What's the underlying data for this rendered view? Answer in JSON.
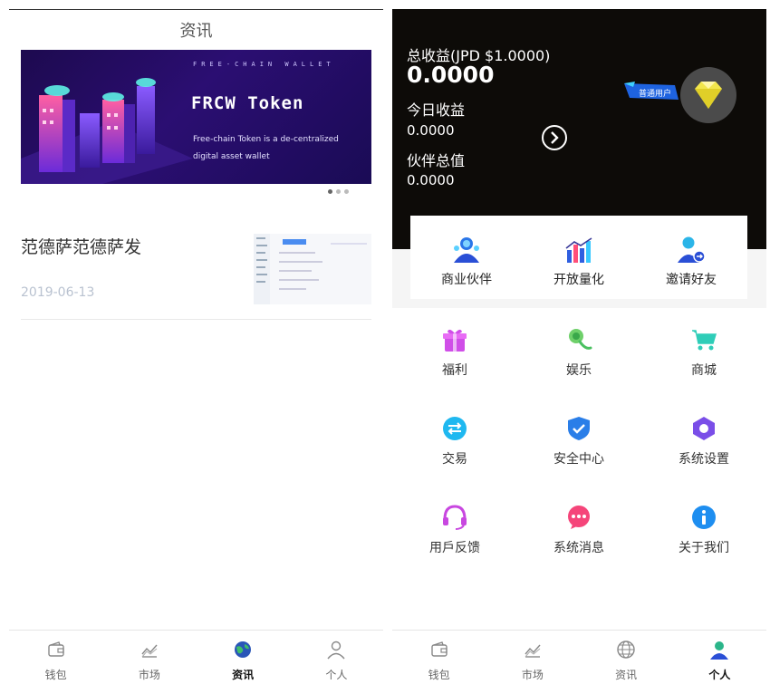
{
  "news_page": {
    "title": "资讯",
    "banner": {
      "top_text": "FREE-CHAIN WALLET",
      "token_title": "FRCW Token",
      "description": "Free-chain Token is a de-centralized digital asset wallet"
    },
    "articles": [
      {
        "title": "范德萨范德萨发",
        "date": "2019-06-13"
      }
    ]
  },
  "profile_page": {
    "total_label": "总收益(JPD $1.0000)",
    "total_value": "0.0000",
    "today_label": "今日收益",
    "today_value": "0.0000",
    "partner_label": "伙伴总值",
    "partner_value": "0.0000",
    "user_badge": "普通用户",
    "top_actions": [
      {
        "label": "商业伙伴",
        "icon": "partners-icon"
      },
      {
        "label": "开放量化",
        "icon": "quant-chart-icon"
      },
      {
        "label": "邀请好友",
        "icon": "invite-friend-icon"
      }
    ],
    "grid": [
      {
        "label": "福利",
        "icon": "gift-icon"
      },
      {
        "label": "娱乐",
        "icon": "entertainment-icon"
      },
      {
        "label": "商城",
        "icon": "cart-icon"
      },
      {
        "label": "交易",
        "icon": "exchange-icon"
      },
      {
        "label": "安全中心",
        "icon": "shield-check-icon"
      },
      {
        "label": "系统设置",
        "icon": "settings-hexagon-icon"
      },
      {
        "label": "用戶反馈",
        "icon": "headset-icon"
      },
      {
        "label": "系统消息",
        "icon": "message-icon"
      },
      {
        "label": "关于我们",
        "icon": "info-icon"
      }
    ]
  },
  "tabbar": {
    "tabs": [
      {
        "label": "钱包",
        "icon": "wallet-icon"
      },
      {
        "label": "市场",
        "icon": "market-chart-icon"
      },
      {
        "label": "资讯",
        "icon": "globe-icon"
      },
      {
        "label": "个人",
        "icon": "user-icon"
      }
    ]
  },
  "colors": {
    "dark_header": "#0d0b08",
    "banner_bg": "#2b0e72",
    "badge_blue": "#1e63e0",
    "diamond_yellow": "#f2e64c"
  }
}
